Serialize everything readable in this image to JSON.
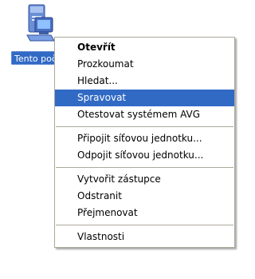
{
  "desktop_icon": {
    "label": "Tento počítač",
    "icon": "computer-icon"
  },
  "context_menu": {
    "groups": [
      [
        {
          "label": "Otevřít",
          "bold": true,
          "selected": false
        },
        {
          "label": "Prozkoumat",
          "bold": false,
          "selected": false
        },
        {
          "label": "Hledat...",
          "bold": false,
          "selected": false
        },
        {
          "label": "Spravovat",
          "bold": false,
          "selected": true
        },
        {
          "label": "Otestovat systémem AVG",
          "bold": false,
          "selected": false
        }
      ],
      [
        {
          "label": "Připojit síťovou jednotku...",
          "bold": false,
          "selected": false
        },
        {
          "label": "Odpojit síťovou jednotku...",
          "bold": false,
          "selected": false
        }
      ],
      [
        {
          "label": "Vytvořit zástupce",
          "bold": false,
          "selected": false
        },
        {
          "label": "Odstranit",
          "bold": false,
          "selected": false
        },
        {
          "label": "Přejmenovat",
          "bold": false,
          "selected": false
        }
      ],
      [
        {
          "label": "Vlastnosti",
          "bold": false,
          "selected": false
        }
      ]
    ]
  },
  "colors": {
    "selection": "#316ac5",
    "menu_border": "#aca899"
  }
}
